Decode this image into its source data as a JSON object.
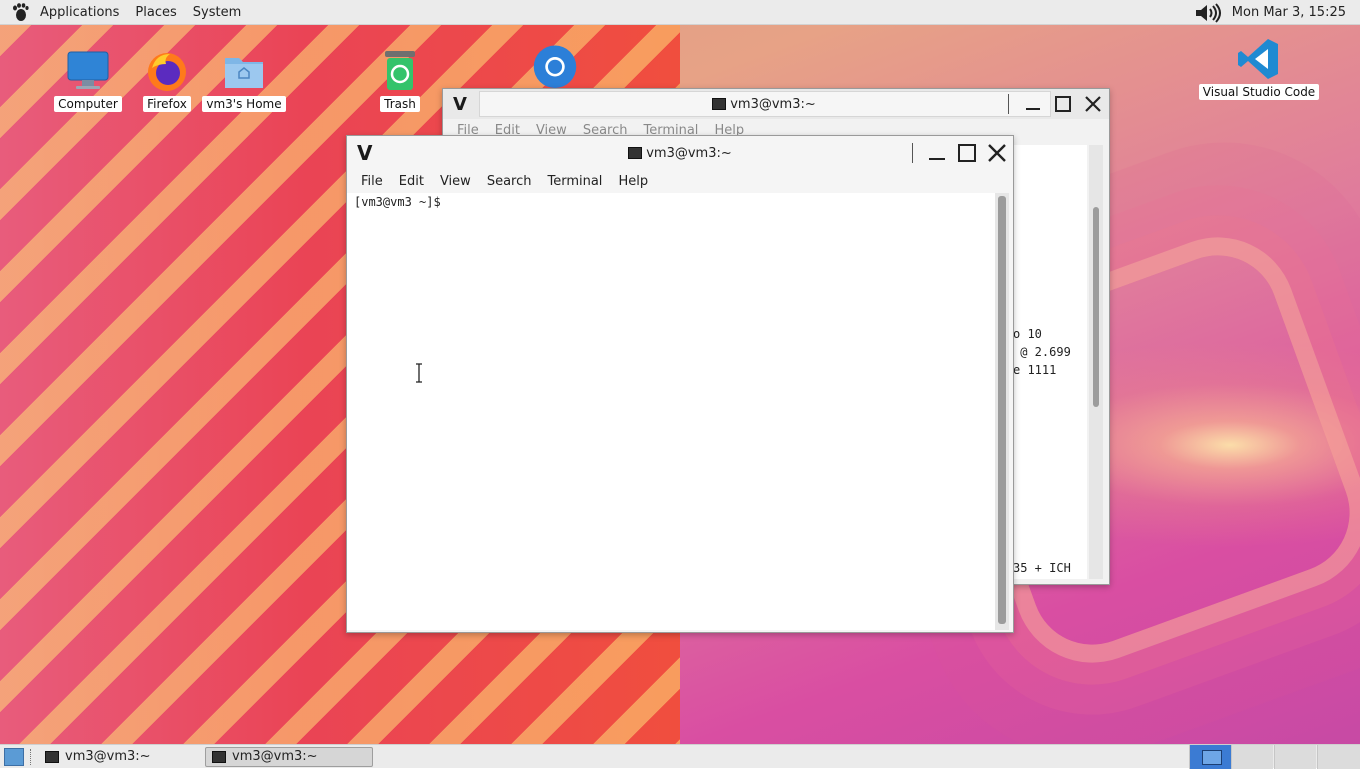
{
  "top_panel": {
    "menu": [
      "Applications",
      "Places",
      "System"
    ],
    "clock": "Mon Mar  3, 15:25"
  },
  "desktop_icons": [
    {
      "label": "Computer",
      "icon": "computer-icon"
    },
    {
      "label": "Firefox",
      "icon": "firefox-icon"
    },
    {
      "label": "vm3's Home",
      "icon": "home-folder-icon"
    },
    {
      "label": "Trash",
      "icon": "trash-icon"
    },
    {
      "label": "",
      "icon": "chrome-icon"
    },
    {
      "label": "Visual Studio Code",
      "icon": "vscode-icon"
    }
  ],
  "back_window": {
    "title": "vm3@vm3:~",
    "menu": [
      "File",
      "Edit",
      "View",
      "Search",
      "Terminal",
      "Help"
    ],
    "visible_text": [
      "o 10",
      " @ 2.699",
      "e 1111",
      "35 + ICH"
    ]
  },
  "front_window": {
    "title": "vm3@vm3:~",
    "menu": [
      "File",
      "Edit",
      "View",
      "Search",
      "Terminal",
      "Help"
    ],
    "prompt": "[vm3@vm3 ~]$"
  },
  "taskbar": {
    "tasks": [
      {
        "label": "vm3@vm3:~",
        "active": false
      },
      {
        "label": "vm3@vm3:~",
        "active": true
      }
    ],
    "workspaces": 4,
    "active_workspace": 1
  },
  "colors": {
    "panel": "#ebebeb",
    "workspace_active": "#3b7bd3"
  }
}
